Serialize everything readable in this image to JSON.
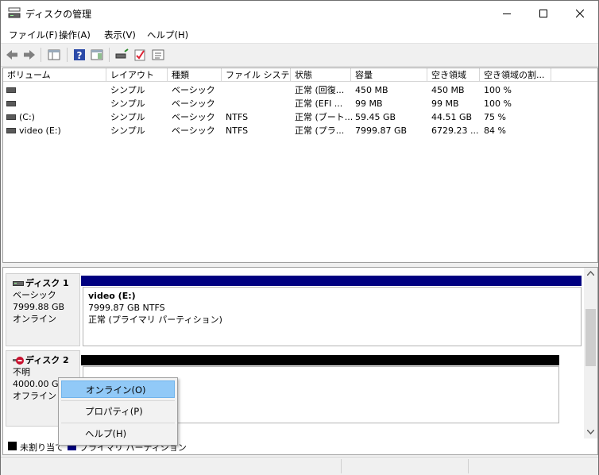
{
  "window": {
    "title": "ディスクの管理",
    "caption": {
      "minimize": "minimize",
      "maximize": "maximize",
      "close": "close"
    }
  },
  "menu": [
    "ファイル(F)",
    "操作(A)",
    "表示(V)",
    "ヘルプ(H)"
  ],
  "toolbar": [
    "back-icon",
    "forward-icon",
    "console-tree-icon",
    "help-icon",
    "show-pane-icon",
    "connect-drive-icon",
    "check-icon",
    "properties-icon"
  ],
  "volume_list": {
    "columns": [
      "ボリューム",
      "レイアウト",
      "種類",
      "ファイル システム",
      "状態",
      "容量",
      "空き領域",
      "空き領域の割..."
    ],
    "rows": [
      [
        "",
        "シンプル",
        "ベーシック",
        "",
        "正常 (回復...",
        "450 MB",
        "450 MB",
        "100 %"
      ],
      [
        "",
        "シンプル",
        "ベーシック",
        "",
        "正常 (EFI ...",
        "99 MB",
        "99 MB",
        "100 %"
      ],
      [
        "(C:)",
        "シンプル",
        "ベーシック",
        "NTFS",
        "正常 (ブート...",
        "59.45 GB",
        "44.51 GB",
        "75 %"
      ],
      [
        "video (E:)",
        "シンプル",
        "ベーシック",
        "NTFS",
        "正常 (プラ...",
        "7999.87 GB",
        "6729.23 ...",
        "84 %"
      ]
    ]
  },
  "disks": [
    {
      "name": "ディスク 1",
      "type": "ベーシック",
      "size": "7999.88 GB",
      "status": "オンライン",
      "bar_color": "#000080",
      "partition": {
        "name": "video  (E:)",
        "size_fs": "7999.87 GB NTFS",
        "status": "正常 (プライマリ パーティション)"
      }
    },
    {
      "name": "ディスク 2",
      "type": "不明",
      "size": "4000.00 GB",
      "status": "オフライン",
      "bar_color": "#000000"
    }
  ],
  "legend": [
    {
      "label": "未割り当て",
      "color": "#000000"
    },
    {
      "label": "プライマリ パーティション",
      "color": "#000080"
    }
  ],
  "context_menu": {
    "items": [
      "オンライン(O)",
      "プロパティ(P)",
      "ヘルプ(H)"
    ],
    "highlight_color": "#91c9f7"
  }
}
